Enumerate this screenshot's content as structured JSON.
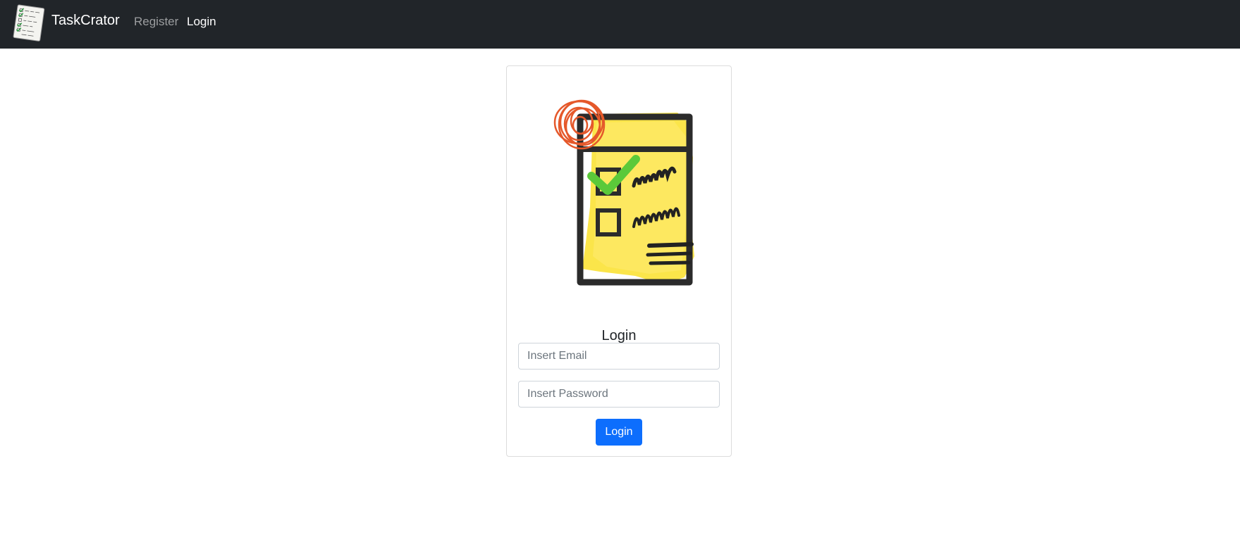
{
  "nav": {
    "brand_name": "TaskCrator",
    "links": [
      {
        "label": "Register",
        "active": false
      },
      {
        "label": "Login",
        "active": true
      }
    ]
  },
  "login_card": {
    "title": "Login",
    "email_placeholder": "Insert Email",
    "email_value": "",
    "password_placeholder": "Insert Password",
    "password_value": "",
    "submit_label": "Login"
  },
  "icons": {
    "brand_logo": "checklist-notepad-icon",
    "illustration": "checklist-illustration"
  },
  "colors": {
    "navbar_bg": "#212529",
    "primary": "#0d6efd",
    "illustration_yellow": "#fbe54a",
    "illustration_green": "#5bc93a",
    "illustration_orange": "#e5582a"
  }
}
